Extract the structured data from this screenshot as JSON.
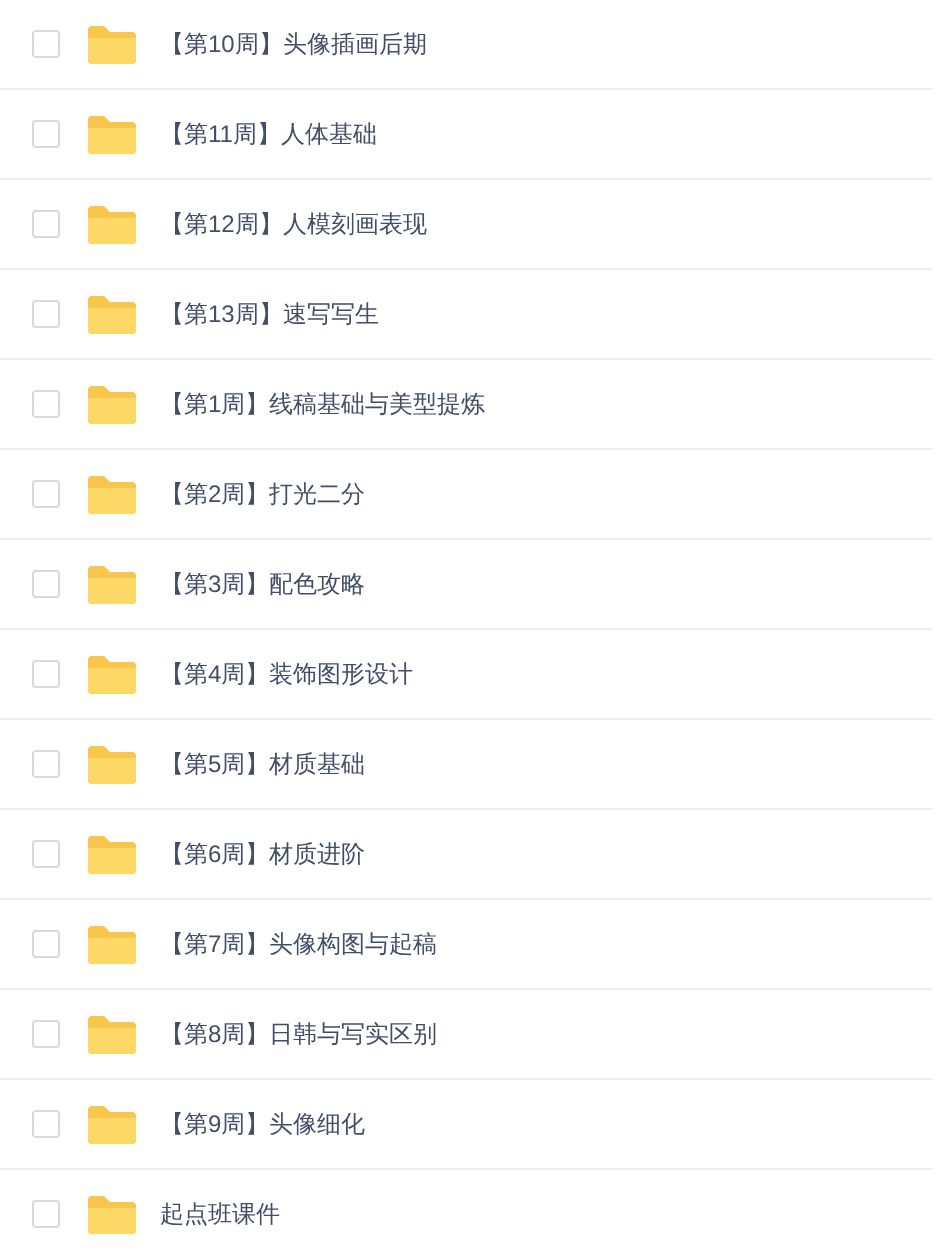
{
  "files": [
    {
      "name": "【第10周】头像插画后期",
      "checked": false
    },
    {
      "name": "【第11周】人体基础",
      "checked": false
    },
    {
      "name": "【第12周】人模刻画表现",
      "checked": false
    },
    {
      "name": "【第13周】速写写生",
      "checked": false
    },
    {
      "name": "【第1周】线稿基础与美型提炼",
      "checked": false
    },
    {
      "name": "【第2周】打光二分",
      "checked": false
    },
    {
      "name": "【第3周】配色攻略",
      "checked": false
    },
    {
      "name": "【第4周】装饰图形设计",
      "checked": false
    },
    {
      "name": "【第5周】材质基础",
      "checked": false
    },
    {
      "name": "【第6周】材质进阶",
      "checked": false
    },
    {
      "name": "【第7周】头像构图与起稿",
      "checked": false
    },
    {
      "name": "【第8周】日韩与写实区别",
      "checked": false
    },
    {
      "name": "【第9周】头像细化",
      "checked": false
    },
    {
      "name": "起点班课件",
      "checked": false
    }
  ]
}
